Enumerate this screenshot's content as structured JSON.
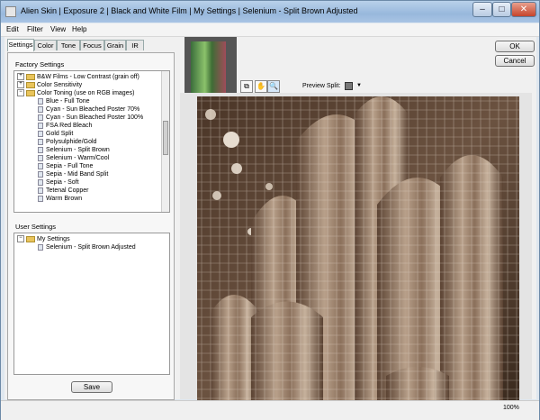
{
  "window": {
    "title": "Alien Skin | Exposure 2 | Black and White Film | My Settings | Selenium - Split Brown Adjusted"
  },
  "titlebar_controls": {
    "minimize": "–",
    "maximize": "□",
    "close": "✕"
  },
  "menu": [
    "Edit",
    "Filter",
    "View",
    "Help"
  ],
  "tabs": [
    "Settings",
    "Color",
    "Tone",
    "Focus",
    "Grain",
    "IR"
  ],
  "factory": {
    "label": "Factory Settings",
    "rows": [
      {
        "type": "folder",
        "exp": "+",
        "text": "B&W Films - Low Contrast (grain off)"
      },
      {
        "type": "folder",
        "exp": "+",
        "text": "Color Sensitivity"
      },
      {
        "type": "folder",
        "exp": "−",
        "text": "Color Toning (use on RGB images)"
      },
      {
        "type": "item",
        "text": "Blue - Full Tone"
      },
      {
        "type": "item",
        "text": "Cyan - Sun Bleached Poster  70%"
      },
      {
        "type": "item",
        "text": "Cyan - Sun Bleached Poster 100%"
      },
      {
        "type": "item",
        "text": "FSA Red Bleach"
      },
      {
        "type": "item",
        "text": "Gold Split"
      },
      {
        "type": "item",
        "text": "Polysulphide/Gold"
      },
      {
        "type": "item",
        "text": "Selenium - Split Brown"
      },
      {
        "type": "item",
        "text": "Selenium - Warm/Cool"
      },
      {
        "type": "item",
        "text": "Sepia - Full Tone"
      },
      {
        "type": "item",
        "text": "Sepia - Mid Band Split"
      },
      {
        "type": "item",
        "text": "Sepia - Soft"
      },
      {
        "type": "item",
        "text": "Tetenal Copper"
      },
      {
        "type": "item",
        "text": "Warm Brown"
      }
    ]
  },
  "user": {
    "label": "User Settings",
    "rows": [
      {
        "type": "folder",
        "exp": "−",
        "text": "My Settings"
      },
      {
        "type": "item",
        "text": "Selenium - Split Brown Adjusted"
      }
    ]
  },
  "buttons": {
    "save": "Save",
    "ok": "OK",
    "cancel": "Cancel"
  },
  "preview": {
    "split_label": "Preview Split:",
    "dropdown_arrow": "▼"
  },
  "toolbar_icons": [
    "compare-icon",
    "hand-icon",
    "zoom-icon"
  ],
  "status": {
    "zoom": "100%"
  },
  "colors": {
    "accent": "#3399ff",
    "sepia_dark": "#3b2a1d",
    "sepia_light": "#e8ddd0"
  }
}
